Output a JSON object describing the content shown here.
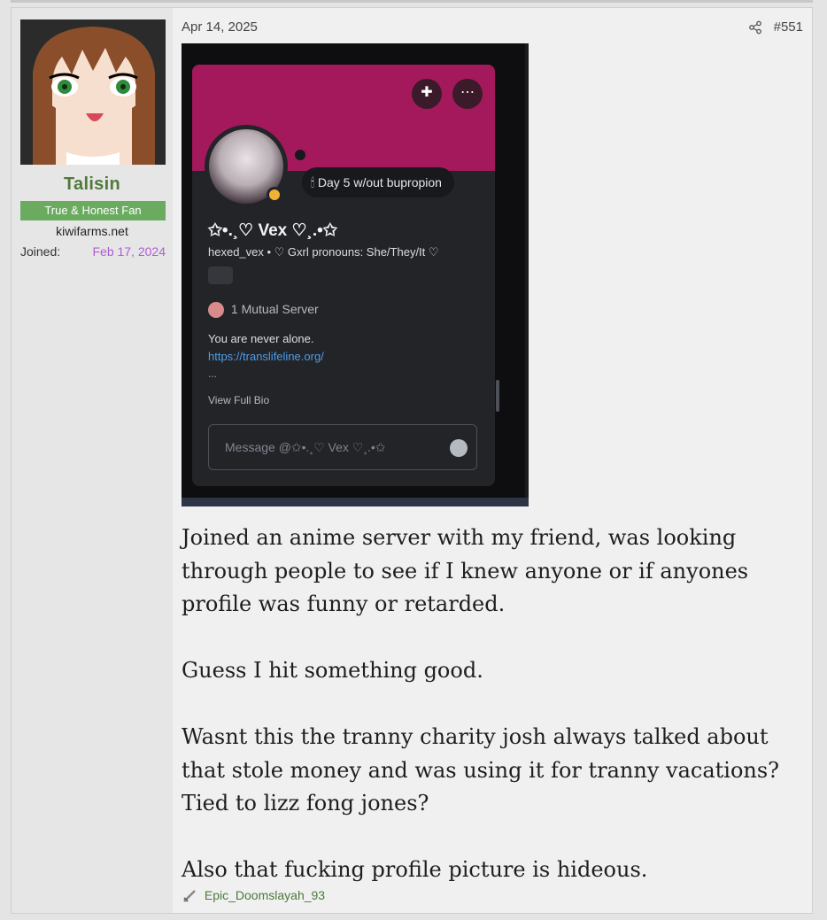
{
  "post": {
    "date": "Apr 14, 2025",
    "number": "#551",
    "share_icon": "share-icon"
  },
  "author": {
    "username": "Talisin",
    "title": "True & Honest Fan",
    "site": "kiwifarms.net",
    "joined_label": "Joined:",
    "joined_date": "Feb 17, 2024",
    "name_color": "#4f7a3b",
    "badge_color": "#6aab60",
    "joined_color": "#b05bd6"
  },
  "screenshot": {
    "status": "Day 5 w/out bupropion",
    "display_name": "✩•.¸♡ Vex ♡¸.•✩",
    "handle_line": "hexed_vex • ♡ Gxrl pronouns: She/They/It ♡",
    "mutual": "1 Mutual Server",
    "bio_line1": "You are never alone.",
    "bio_link": "https://translifeline.org/",
    "bio_more": "...",
    "view_bio": "View Full Bio",
    "message_placeholder": "Message @✩•.¸♡ Vex ♡¸.•✩",
    "banner_color": "#a3195b"
  },
  "body": {
    "p1": "Joined an anime server with my friend, was looking through people to see if I knew anyone or if anyones profile was funny or retarded.",
    "p2": "Guess I hit something good.",
    "p3": "Wasnt this the tranny charity josh always talked about that stole money and was using it for tranny vacations? Tied to lizz fong jones?",
    "p4": "Also that fucking profile picture is hideous."
  },
  "signature": {
    "text": "Epic_Doomslayah_93"
  }
}
